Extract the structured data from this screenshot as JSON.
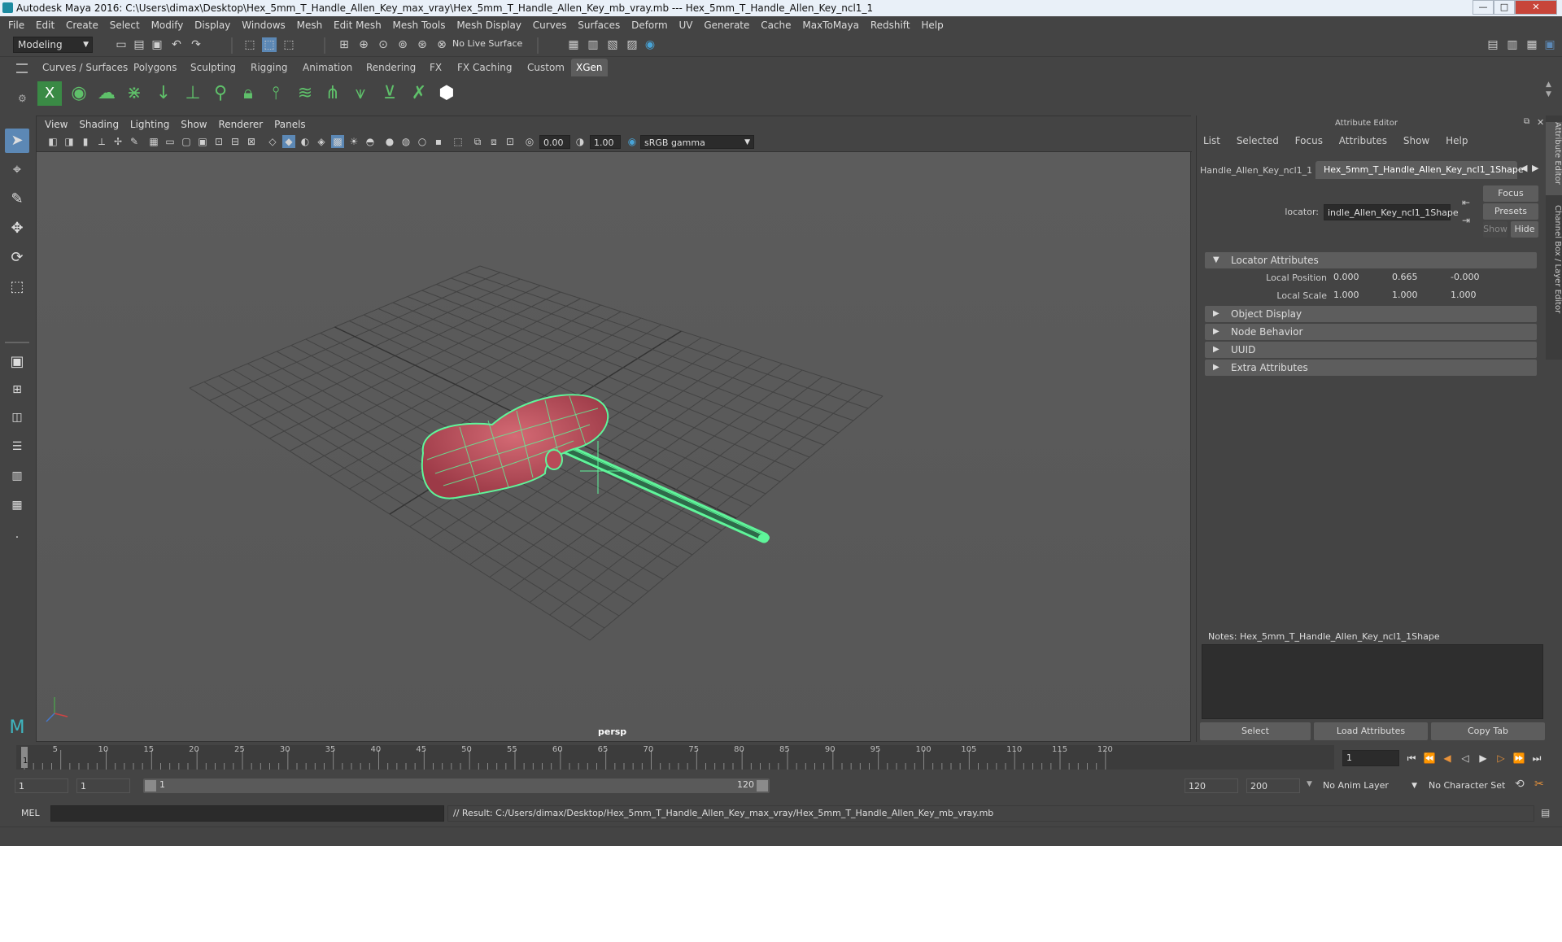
{
  "window": {
    "title": "Autodesk Maya 2016: C:\\Users\\dimax\\Desktop\\Hex_5mm_T_Handle_Allen_Key_max_vray\\Hex_5mm_T_Handle_Allen_Key_mb_vray.mb   ---   Hex_5mm_T_Handle_Allen_Key_ncl1_1",
    "minimize": "—",
    "maximize": "□",
    "close": "✕"
  },
  "menus": [
    "File",
    "Edit",
    "Create",
    "Select",
    "Modify",
    "Display",
    "Windows",
    "Mesh",
    "Edit Mesh",
    "Mesh Tools",
    "Mesh Display",
    "Curves",
    "Surfaces",
    "Deform",
    "UV",
    "Generate",
    "Cache",
    "MaxToMaya",
    "Redshift",
    "Help"
  ],
  "toolbar": {
    "mode": "Modeling",
    "live_surface": "No Live Surface"
  },
  "shelf": {
    "tabs": [
      "Curves / Surfaces",
      "Polygons",
      "Sculpting",
      "Rigging",
      "Animation",
      "Rendering",
      "FX",
      "FX Caching",
      "Custom",
      "XGen"
    ],
    "active_tab": "XGen"
  },
  "viewport": {
    "menus": [
      "View",
      "Shading",
      "Lighting",
      "Show",
      "Renderer",
      "Panels"
    ],
    "exposure": "0.00",
    "gamma": "1.00",
    "color_space": "sRGB gamma",
    "camera_label": "persp"
  },
  "attribute_editor": {
    "title": "Attribute Editor",
    "menus": [
      "List",
      "Selected",
      "Focus",
      "Attributes",
      "Show",
      "Help"
    ],
    "tab_left": "Handle_Allen_Key_ncl1_1",
    "tab_active": "Hex_5mm_T_Handle_Allen_Key_ncl1_1Shape",
    "locator_label": "locator:",
    "locator_value": "indle_Allen_Key_ncl1_1Shape",
    "focus_btn": "Focus",
    "presets_btn": "Presets",
    "show_btn": "Show",
    "hide_btn": "Hide",
    "sections": {
      "locator": "Locator Attributes",
      "object_display": "Object Display",
      "node_behavior": "Node Behavior",
      "uuid": "UUID",
      "extra": "Extra Attributes"
    },
    "local_position_label": "Local Position",
    "local_position": [
      "0.000",
      "0.665",
      "-0.000"
    ],
    "local_scale_label": "Local Scale",
    "local_scale": [
      "1.000",
      "1.000",
      "1.000"
    ],
    "notes": "Notes:  Hex_5mm_T_Handle_Allen_Key_ncl1_1Shape",
    "select_btn": "Select",
    "load_btn": "Load Attributes",
    "copy_btn": "Copy Tab"
  },
  "side_tabs": [
    "Attribute Editor",
    "Channel Box / Layer Editor"
  ],
  "timeline": {
    "ticks": [
      "5",
      "10",
      "15",
      "20",
      "25",
      "30",
      "35",
      "40",
      "45",
      "50",
      "55",
      "60",
      "65",
      "70",
      "75",
      "80",
      "85",
      "90",
      "95",
      "100",
      "105",
      "110",
      "115",
      "120"
    ],
    "start_label": "1",
    "current_frame": "1"
  },
  "range": {
    "start": "1",
    "start2": "1",
    "slider_start": "1",
    "slider_end": "120",
    "end": "120",
    "end2": "200",
    "anim_layer": "No Anim Layer",
    "char_set": "No Character Set"
  },
  "command": {
    "lang": "MEL",
    "result": "// Result: C:/Users/dimax/Desktop/Hex_5mm_T_Handle_Allen_Key_max_vray/Hex_5mm_T_Handle_Allen_Key_mb_vray.mb"
  },
  "colors": {
    "accent": "#5c88b5",
    "wire": "#5ff59a",
    "handle": "#b84a58",
    "grid": "#3e3e3e"
  }
}
